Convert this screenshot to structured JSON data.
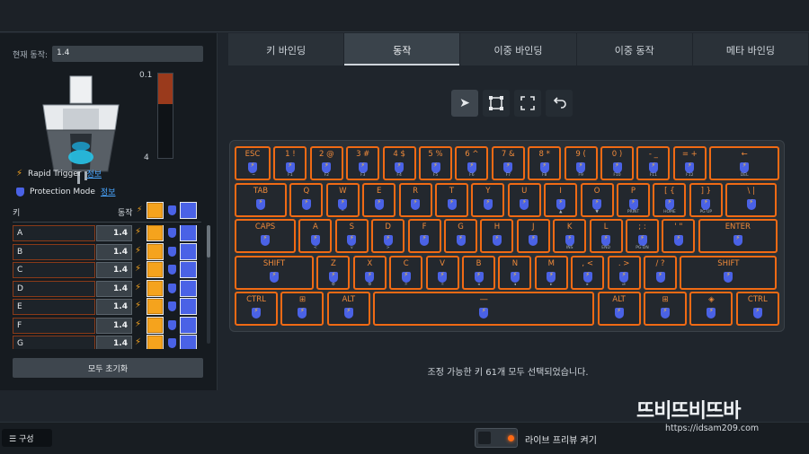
{
  "current_action": {
    "label": "현재 동작:",
    "value": "1.4"
  },
  "scale": {
    "top": "0.1",
    "bottom": "4",
    "fill_fraction": 0.36
  },
  "features": [
    {
      "name": "Rapid Trigger",
      "link": "정보",
      "icon": "bolt-icon"
    },
    {
      "name": "Protection Mode",
      "link": "정보",
      "icon": "shield-icon"
    }
  ],
  "key_table": {
    "col_key": "키",
    "col_action": "동작",
    "rows": [
      {
        "key": "A",
        "value": "1.4"
      },
      {
        "key": "B",
        "value": "1.4"
      },
      {
        "key": "C",
        "value": "1.4"
      },
      {
        "key": "D",
        "value": "1.4"
      },
      {
        "key": "E",
        "value": "1.4"
      },
      {
        "key": "F",
        "value": "1.4"
      },
      {
        "key": "G",
        "value": "1.4"
      }
    ]
  },
  "reset_label": "모두 초기화",
  "tabs": [
    "키 바인딩",
    "동작",
    "이중 바인딩",
    "이중 동작",
    "메타 바인딩"
  ],
  "active_tab": 1,
  "tools": [
    "pointer-icon",
    "select-box-icon",
    "expand-icon",
    "undo-icon"
  ],
  "keyboard": {
    "rows": [
      [
        {
          "l": "ESC",
          "s": "`~"
        },
        {
          "l": "1 !",
          "s": "F1"
        },
        {
          "l": "2 @",
          "s": "F2"
        },
        {
          "l": "3 #",
          "s": "F3"
        },
        {
          "l": "4 $",
          "s": "F4"
        },
        {
          "l": "5 %",
          "s": "F5"
        },
        {
          "l": "6 ^",
          "s": "F6"
        },
        {
          "l": "7 &",
          "s": "F7"
        },
        {
          "l": "8 *",
          "s": "F8"
        },
        {
          "l": "9 (",
          "s": "F9"
        },
        {
          "l": "0 )",
          "s": "F10"
        },
        {
          "l": "- _",
          "s": "F11"
        },
        {
          "l": "= +",
          "s": "F12"
        },
        {
          "l": "←",
          "s": "DEL"
        }
      ],
      [
        {
          "l": "TAB",
          "s": ""
        },
        {
          "l": "Q",
          "s": ""
        },
        {
          "l": "W",
          "s": "^"
        },
        {
          "l": "E",
          "s": ""
        },
        {
          "l": "R",
          "s": ""
        },
        {
          "l": "T",
          "s": ""
        },
        {
          "l": "Y",
          "s": ""
        },
        {
          "l": "U",
          "s": ""
        },
        {
          "l": "I",
          "s": "▲"
        },
        {
          "l": "O",
          "s": "▼"
        },
        {
          "l": "P",
          "s": "PRINT"
        },
        {
          "l": "[ {",
          "s": "HOME"
        },
        {
          "l": "] }",
          "s": "PG UP"
        },
        {
          "l": "\\ |",
          "s": ""
        }
      ],
      [
        {
          "l": "CAPS",
          "s": ""
        },
        {
          "l": "A",
          "s": "<"
        },
        {
          "l": "S",
          "s": "v"
        },
        {
          "l": "D",
          "s": ">"
        },
        {
          "l": "F",
          "s": ""
        },
        {
          "l": "G",
          "s": ""
        },
        {
          "l": "H",
          "s": ""
        },
        {
          "l": "J",
          "s": ""
        },
        {
          "l": "K",
          "s": "INS"
        },
        {
          "l": "L",
          "s": "END"
        },
        {
          "l": "; :",
          "s": "PG DN"
        },
        {
          "l": "' \"",
          "s": ""
        },
        {
          "l": "ENTER",
          "s": ""
        }
      ],
      [
        {
          "l": "SHIFT",
          "s": ""
        },
        {
          "l": "Z",
          "s": "⚙"
        },
        {
          "l": "X",
          "s": "⚙"
        },
        {
          "l": "C",
          "s": "☼"
        },
        {
          "l": "V",
          "s": "☼"
        },
        {
          "l": "B",
          "s": "◂"
        },
        {
          "l": "N",
          "s": "◂"
        },
        {
          "l": "M",
          "s": "▸"
        },
        {
          "l": ", <",
          "s": "▸"
        },
        {
          "l": ". >",
          "s": "⏯"
        },
        {
          "l": "/ ?",
          "s": ""
        },
        {
          "l": "SHIFT",
          "s": ""
        }
      ],
      [
        {
          "l": "CTRL",
          "s": ""
        },
        {
          "l": "⊞",
          "s": ""
        },
        {
          "l": "ALT",
          "s": ""
        },
        {
          "l": "―",
          "s": ""
        },
        {
          "l": "ALT",
          "s": ""
        },
        {
          "l": "⊞",
          "s": ""
        },
        {
          "l": "◈",
          "s": ""
        },
        {
          "l": "CTRL",
          "s": ""
        }
      ]
    ]
  },
  "status_message": "조정 가능한 키 61개 모두 선택되었습니다.",
  "bottom": {
    "config_label": "구성",
    "live_preview_label": "라이브 프리뷰 켜기"
  },
  "watermark": {
    "title": "뜨비뜨비뜨바",
    "url": "https://idsam209.com"
  },
  "colors": {
    "key_border": "#f06a14",
    "bolt": "#f5a31d",
    "shield": "#4a62e6",
    "link": "#4aa6ff"
  }
}
